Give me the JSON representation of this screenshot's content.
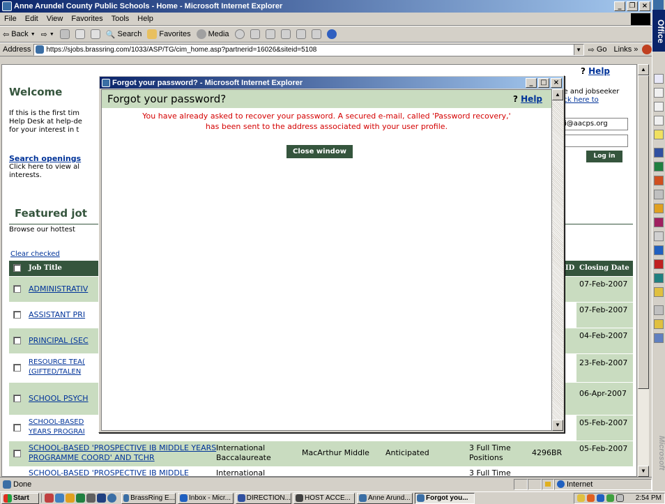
{
  "window": {
    "title": "Anne Arundel County Public Schools - Home - Microsoft Internet Explorer",
    "menu": [
      "File",
      "Edit",
      "View",
      "Favorites",
      "Tools",
      "Help"
    ],
    "toolbar": {
      "back": "Back",
      "forward": "",
      "search": "Search",
      "favorites": "Favorites",
      "media": "Media"
    },
    "address_label": "Address",
    "address": "https://sjobs.brassring.com/1033/ASP/TG/cim_home.asp?partnerid=16026&siteid=5108",
    "go": "Go",
    "links": "Links"
  },
  "page": {
    "help": "Help",
    "welcome": "Welcome",
    "intro_lines": [
      "If this is the first tim",
      "Help Desk at help-de",
      "for your interest in t"
    ],
    "right_text_1": "ile and jobseeker",
    "right_link": "lick here to",
    "email_value": "i@aacps.org",
    "login_button": "Log in",
    "search_heading": "Search openings",
    "search_desc_lines": [
      "Click here to view al",
      "interests."
    ],
    "featured_heading": "Featured jot",
    "featured_desc": "Browse our hottest",
    "clear_checked": "Clear checked",
    "col_job_title": "Job Title",
    "col_id": "ID",
    "col_closing": "Closing Date",
    "jobs": [
      {
        "title": "ADMINISTRATIV",
        "closing": "07-Feb-2007"
      },
      {
        "title": "ASSISTANT PRI",
        "closing": "07-Feb-2007"
      },
      {
        "title": "PRINCIPAL (SEC",
        "closing": "04-Feb-2007"
      },
      {
        "title": "RESOURCE TEA( (GIFTED/TALEN",
        "closing": "23-Feb-2007"
      },
      {
        "title": "SCHOOL PSYCH",
        "closing": "06-Apr-2007"
      },
      {
        "title": "SCHOOL-BASED YEARS PROGRAI",
        "closing": "05-Feb-2007"
      }
    ],
    "full_row": {
      "title": "SCHOOL-BASED 'PROSPECTIVE IB MIDDLE YEARS PROGRAMME COORD' AND TCHR",
      "category": "International Baccalaureate",
      "location": "MacArthur Middle",
      "status": "Anticipated",
      "positions": "3 Full Time Positions",
      "id": "4296BR",
      "closing": "05-Feb-2007"
    },
    "cut_row": {
      "title": "SCHOOL-BASED 'PROSPECTIVE IB MIDDLE",
      "category": "International",
      "positions": "3 Full Time"
    }
  },
  "popup": {
    "title": "Forgot your password? - Microsoft Internet Explorer",
    "heading": "Forgot your password?",
    "help": "Help",
    "message_line1": "You have already asked to recover your password. A secured e-mail, called 'Password recovery,'",
    "message_line2": "has been sent to the address associated with your user profile.",
    "close_button": "Close window"
  },
  "status": {
    "text": "Done",
    "zone": "Internet"
  },
  "taskbar": {
    "start": "Start",
    "tasks": [
      "BrassRing E...",
      "Inbox - Micr...",
      "DIRECTION...",
      "HOST ACCE...",
      "Anne Arund...",
      "Forgot you..."
    ],
    "clock": "2:54 PM"
  },
  "officebar": {
    "label_top": "Office",
    "label_bottom": "Microsoft"
  },
  "colors": {
    "header_green": "#35553d",
    "row_green": "#c9dcc0",
    "alert_red": "#d40000",
    "link_blue": "#003399"
  }
}
